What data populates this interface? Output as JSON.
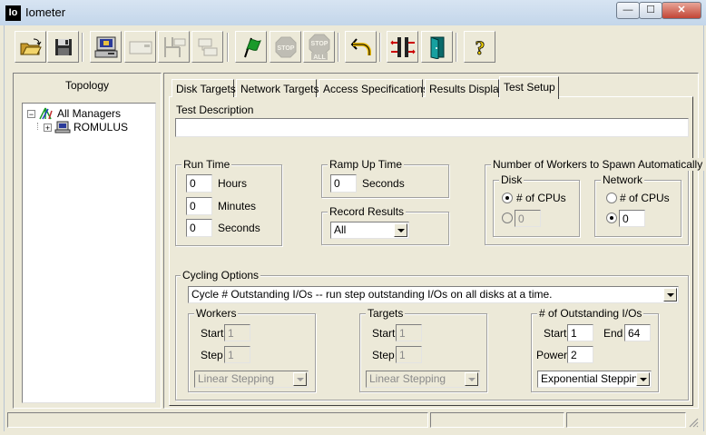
{
  "window": {
    "app_icon_text": "Io",
    "title": "Iometer",
    "minimize": "—",
    "maximize": "☐",
    "close": "✕"
  },
  "toolbar": {
    "buttons": [
      {
        "icon": "open-folder-icon",
        "enabled": true
      },
      {
        "icon": "save-disk-icon",
        "enabled": true
      },
      {
        "icon": "new-disk-worker-icon",
        "enabled": true
      },
      {
        "icon": "new-network-worker-icon",
        "enabled": false
      },
      {
        "icon": "duplicate-worker-icon",
        "enabled": false
      },
      {
        "icon": "disconnect-manager-icon",
        "enabled": false
      },
      {
        "icon": "start-green-flag-icon",
        "enabled": true
      },
      {
        "icon": "stop-icon",
        "enabled": false,
        "text": "STOP"
      },
      {
        "icon": "stop-all-icon",
        "enabled": false,
        "text": "STOP ALL"
      },
      {
        "icon": "reset-workers-icon",
        "enabled": true
      },
      {
        "icon": "new-manager-icon",
        "enabled": true
      },
      {
        "icon": "exit-door-icon",
        "enabled": true
      },
      {
        "icon": "help-icon",
        "enabled": true,
        "text": "?"
      }
    ]
  },
  "topology": {
    "title": "Topology",
    "tree": [
      {
        "label": "All Managers",
        "expander": "−",
        "icon": "all-managers-icon"
      },
      {
        "label": "ROMULUS",
        "expander": "+",
        "icon": "computer-icon"
      }
    ]
  },
  "tabs": [
    {
      "label": "Disk Targets",
      "active": false
    },
    {
      "label": "Network Targets",
      "active": false
    },
    {
      "label": "Access Specifications",
      "active": false
    },
    {
      "label": "Results Display",
      "active": false
    },
    {
      "label": "Test Setup",
      "active": true
    }
  ],
  "test_setup": {
    "description_label": "Test Description",
    "description_value": "",
    "run_time": {
      "title": "Run Time",
      "fields": [
        {
          "value": "0",
          "unit": "Hours"
        },
        {
          "value": "0",
          "unit": "Minutes"
        },
        {
          "value": "0",
          "unit": "Seconds"
        }
      ]
    },
    "ramp_up": {
      "title": "Ramp Up Time",
      "value": "0",
      "unit": "Seconds"
    },
    "record_results": {
      "title": "Record Results",
      "selected": "All"
    },
    "workers_spawn": {
      "title": "Number of Workers to Spawn Automatically",
      "disk": {
        "title": "Disk",
        "cpus_label": "# of CPUs",
        "cpus_checked": true,
        "custom_value": "0",
        "custom_checked": false,
        "custom_enabled": false
      },
      "network": {
        "title": "Network",
        "cpus_label": "# of CPUs",
        "cpus_checked": false,
        "custom_value": "0",
        "custom_checked": true
      }
    },
    "cycling": {
      "title": "Cycling Options",
      "selected": "Cycle # Outstanding I/Os -- run step outstanding I/Os on all disks at a time.",
      "workers": {
        "title": "Workers",
        "start_label": "Start",
        "start_value": "1",
        "step_label": "Step",
        "step_value": "1",
        "stepping": "Linear Stepping"
      },
      "targets": {
        "title": "Targets",
        "start_label": "Start",
        "start_value": "1",
        "step_label": "Step",
        "step_value": "1",
        "stepping": "Linear Stepping"
      },
      "outstanding": {
        "title": "# of Outstanding I/Os",
        "start_label": "Start",
        "start_value": "1",
        "end_label": "End",
        "end_value": "64",
        "power_label": "Power",
        "power_value": "2",
        "stepping": "Exponential Stepping"
      }
    }
  },
  "colors": {
    "face": "#ece9d8",
    "title_bar": "#c3d6ea",
    "close_button": "#c24535",
    "start_flag": "#1a9a2a",
    "stop_sign": "#8a8a8a",
    "help": "#f0d000"
  }
}
